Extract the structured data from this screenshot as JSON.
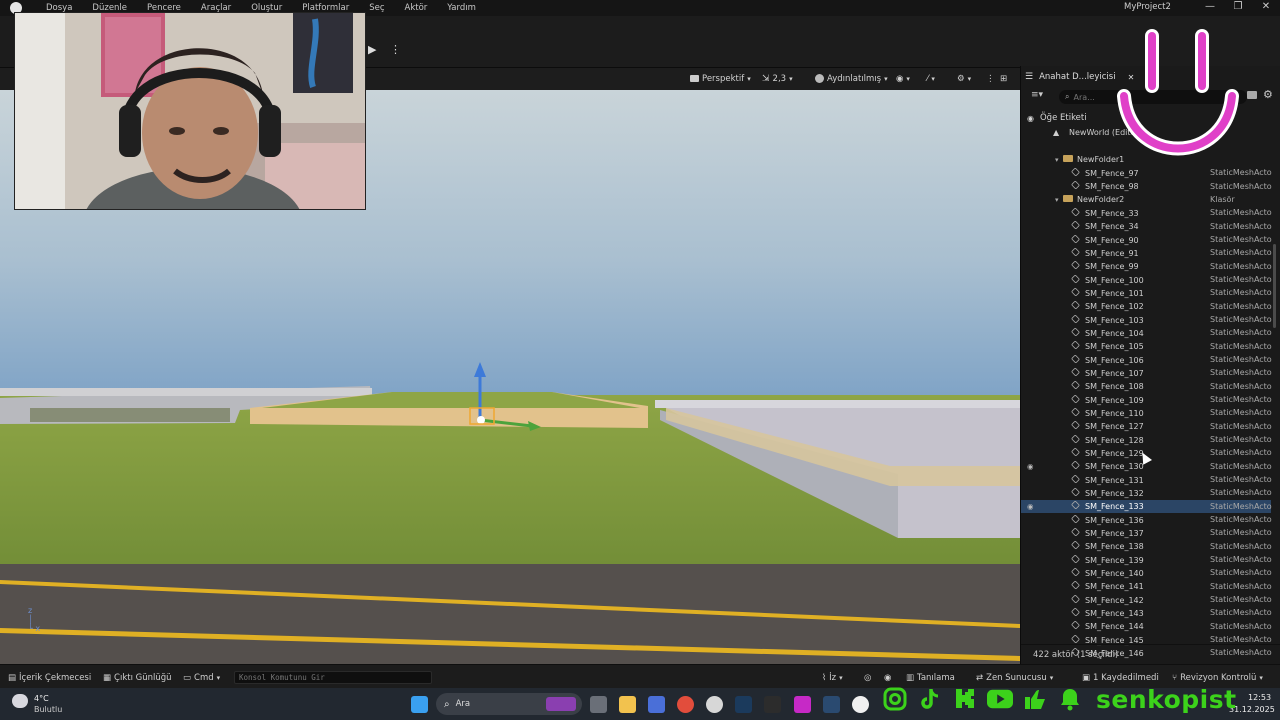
{
  "menubar": {
    "items": [
      "Dosya",
      "Düzenle",
      "Pencere",
      "Araçlar",
      "Oluştur",
      "Platformlar",
      "Seç",
      "Aktör",
      "Yardım"
    ],
    "project_title": "MyProject2",
    "window_controls": [
      "—",
      "❐",
      "✕"
    ]
  },
  "viewport": {
    "perspective_label": "Perspektif",
    "speed_value": "2,3",
    "lighting_label": "Aydınlatılmış"
  },
  "outliner": {
    "tab_title": "Anahat D...leyicisi",
    "close_label": "✕",
    "search_placeholder": "Ara...",
    "header_label": "Öğe Etiketi",
    "world_label": "NewWorld (Editö",
    "rows": [
      {
        "label": "NewFolder1",
        "type": "",
        "kind": "folder",
        "indent": 2
      },
      {
        "label": "SM_Fence_97",
        "type": "StaticMeshActo",
        "kind": "mesh",
        "indent": 3
      },
      {
        "label": "SM_Fence_98",
        "type": "StaticMeshActo",
        "kind": "mesh",
        "indent": 3
      },
      {
        "label": "NewFolder2",
        "type": "Klasör",
        "kind": "folder",
        "indent": 2
      },
      {
        "label": "SM_Fence_33",
        "type": "StaticMeshActo",
        "kind": "mesh",
        "indent": 3
      },
      {
        "label": "SM_Fence_34",
        "type": "StaticMeshActo",
        "kind": "mesh",
        "indent": 3
      },
      {
        "label": "SM_Fence_90",
        "type": "StaticMeshActo",
        "kind": "mesh",
        "indent": 3
      },
      {
        "label": "SM_Fence_91",
        "type": "StaticMeshActo",
        "kind": "mesh",
        "indent": 3
      },
      {
        "label": "SM_Fence_99",
        "type": "StaticMeshActo",
        "kind": "mesh",
        "indent": 3
      },
      {
        "label": "SM_Fence_100",
        "type": "StaticMeshActo",
        "kind": "mesh",
        "indent": 3
      },
      {
        "label": "SM_Fence_101",
        "type": "StaticMeshActo",
        "kind": "mesh",
        "indent": 3
      },
      {
        "label": "SM_Fence_102",
        "type": "StaticMeshActo",
        "kind": "mesh",
        "indent": 3
      },
      {
        "label": "SM_Fence_103",
        "type": "StaticMeshActo",
        "kind": "mesh",
        "indent": 3
      },
      {
        "label": "SM_Fence_104",
        "type": "StaticMeshActo",
        "kind": "mesh",
        "indent": 3
      },
      {
        "label": "SM_Fence_105",
        "type": "StaticMeshActo",
        "kind": "mesh",
        "indent": 3
      },
      {
        "label": "SM_Fence_106",
        "type": "StaticMeshActo",
        "kind": "mesh",
        "indent": 3
      },
      {
        "label": "SM_Fence_107",
        "type": "StaticMeshActo",
        "kind": "mesh",
        "indent": 3
      },
      {
        "label": "SM_Fence_108",
        "type": "StaticMeshActo",
        "kind": "mesh",
        "indent": 3
      },
      {
        "label": "SM_Fence_109",
        "type": "StaticMeshActo",
        "kind": "mesh",
        "indent": 3
      },
      {
        "label": "SM_Fence_110",
        "type": "StaticMeshActo",
        "kind": "mesh",
        "indent": 3
      },
      {
        "label": "SM_Fence_127",
        "type": "StaticMeshActo",
        "kind": "mesh",
        "indent": 3
      },
      {
        "label": "SM_Fence_128",
        "type": "StaticMeshActo",
        "kind": "mesh",
        "indent": 3
      },
      {
        "label": "SM_Fence_129",
        "type": "StaticMeshActo",
        "kind": "mesh",
        "indent": 3
      },
      {
        "label": "SM_Fence_130",
        "type": "StaticMeshActo",
        "kind": "mesh",
        "indent": 3,
        "eye": true
      },
      {
        "label": "SM_Fence_131",
        "type": "StaticMeshActo",
        "kind": "mesh",
        "indent": 3
      },
      {
        "label": "SM_Fence_132",
        "type": "StaticMeshActo",
        "kind": "mesh",
        "indent": 3
      },
      {
        "label": "SM_Fence_133",
        "type": "StaticMeshActo",
        "kind": "mesh",
        "indent": 3,
        "eye": true,
        "selected": true
      },
      {
        "label": "SM_Fence_136",
        "type": "StaticMeshActo",
        "kind": "mesh",
        "indent": 3
      },
      {
        "label": "SM_Fence_137",
        "type": "StaticMeshActo",
        "kind": "mesh",
        "indent": 3
      },
      {
        "label": "SM_Fence_138",
        "type": "StaticMeshActo",
        "kind": "mesh",
        "indent": 3
      },
      {
        "label": "SM_Fence_139",
        "type": "StaticMeshActo",
        "kind": "mesh",
        "indent": 3
      },
      {
        "label": "SM_Fence_140",
        "type": "StaticMeshActo",
        "kind": "mesh",
        "indent": 3
      },
      {
        "label": "SM_Fence_141",
        "type": "StaticMeshActo",
        "kind": "mesh",
        "indent": 3
      },
      {
        "label": "SM_Fence_142",
        "type": "StaticMeshActo",
        "kind": "mesh",
        "indent": 3
      },
      {
        "label": "SM_Fence_143",
        "type": "StaticMeshActo",
        "kind": "mesh",
        "indent": 3
      },
      {
        "label": "SM_Fence_144",
        "type": "StaticMeshActo",
        "kind": "mesh",
        "indent": 3
      },
      {
        "label": "SM_Fence_145",
        "type": "StaticMeshActo",
        "kind": "mesh",
        "indent": 3
      },
      {
        "label": "SM_Fence_146",
        "type": "StaticMeshActo",
        "kind": "mesh",
        "indent": 3
      }
    ],
    "footer": "422 aktör (1 seçildi)"
  },
  "statusbar": {
    "content_drawer": "İçerik Çekmecesi",
    "output_log": "Çıktı Günlüğü",
    "cmd": "Cmd",
    "console_placeholder": "Konsol Komutunu Gir",
    "trace": "İz",
    "derived": "Tanılama",
    "zen": "Zen Sunucusu",
    "saved": "1 Kaydedilmedi",
    "revision": "Revizyon Kontrolü"
  },
  "taskbar": {
    "weather_temp": "4°C",
    "weather_desc": "Bulutlu",
    "search_label": "Ara",
    "time": "12:53",
    "date": "31.12.2025"
  },
  "overlay": {
    "brand_name": "senkopist",
    "brand_color": "#3cd21b",
    "smiley_color": "#e040c8"
  }
}
